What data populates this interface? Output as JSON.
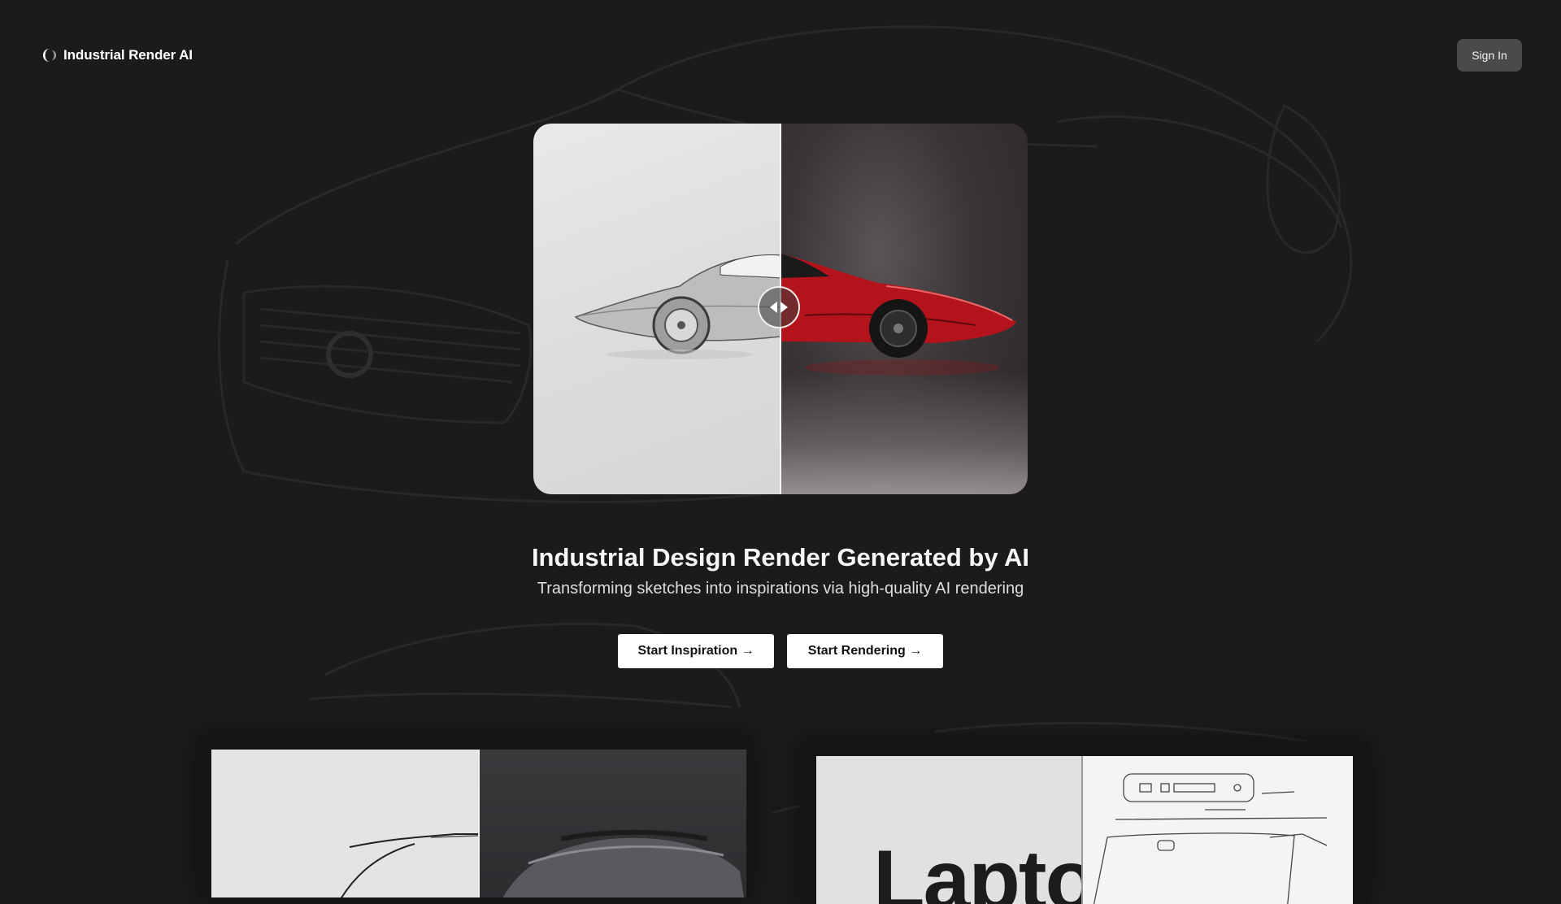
{
  "header": {
    "logo_text": "Industrial Render AI",
    "signin_label": "Sign In"
  },
  "hero": {
    "title": "Industrial Design Render Generated by AI",
    "subtitle": "Transforming sketches into inspirations via high-quality AI rendering",
    "compare_handle": "compare-slider-handle",
    "compare_position": 0.5
  },
  "actions": {
    "start_inspiration": "Start Inspiration →",
    "start_rendering": "Start Rendering →"
  },
  "showcase": {
    "card2_word": "Lapto"
  },
  "colors": {
    "background": "#1b1b1b",
    "signin_bg": "#4a4a4d",
    "cta_bg": "#ffffff",
    "car_red": "#b3141b"
  }
}
